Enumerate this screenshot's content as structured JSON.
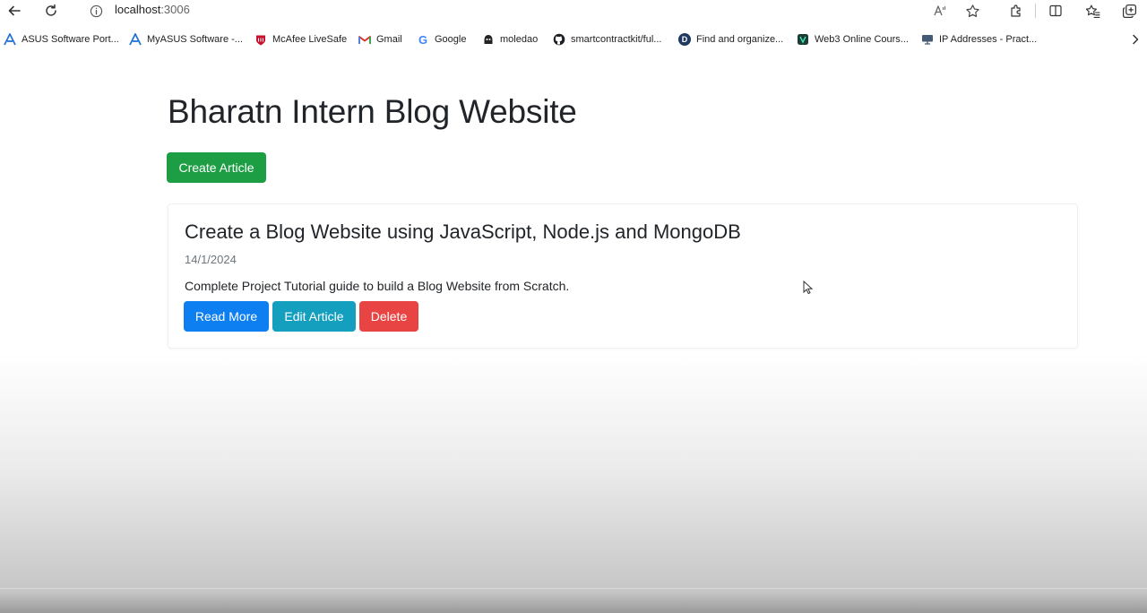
{
  "browser": {
    "url_host": "localhost",
    "url_port": ":3006"
  },
  "bookmarks": [
    {
      "label": "ASUS Software Port...",
      "icon": "asus-icon"
    },
    {
      "label": "MyASUS Software -...",
      "icon": "asus-icon"
    },
    {
      "label": "McAfee LiveSafe",
      "icon": "mcafee-icon"
    },
    {
      "label": "Gmail",
      "icon": "gmail-icon"
    },
    {
      "label": "Google",
      "icon": "google-icon"
    },
    {
      "label": "moledao",
      "icon": "moledao-icon"
    },
    {
      "label": "smartcontractkit/ful...",
      "icon": "github-icon"
    },
    {
      "label": "Find and organize...",
      "icon": "d-icon"
    },
    {
      "label": "Web3 Online Cours...",
      "icon": "web3-icon"
    },
    {
      "label": "IP Addresses - Pract...",
      "icon": "computer-icon"
    }
  ],
  "page": {
    "title": "Bharatn Intern Blog Website",
    "create_label": "Create Article"
  },
  "article": {
    "title": "Create a Blog Website using JavaScript, Node.js and MongoDB",
    "date": "14/1/2024",
    "description": "Complete Project Tutorial guide to build a Blog Website from Scratch.",
    "read_more_label": "Read More",
    "edit_label": "Edit Article",
    "delete_label": "Delete"
  },
  "colors": {
    "success": "#1e9e44",
    "primary": "#0d7ff0",
    "info": "#139fbd",
    "danger": "#e84444"
  }
}
